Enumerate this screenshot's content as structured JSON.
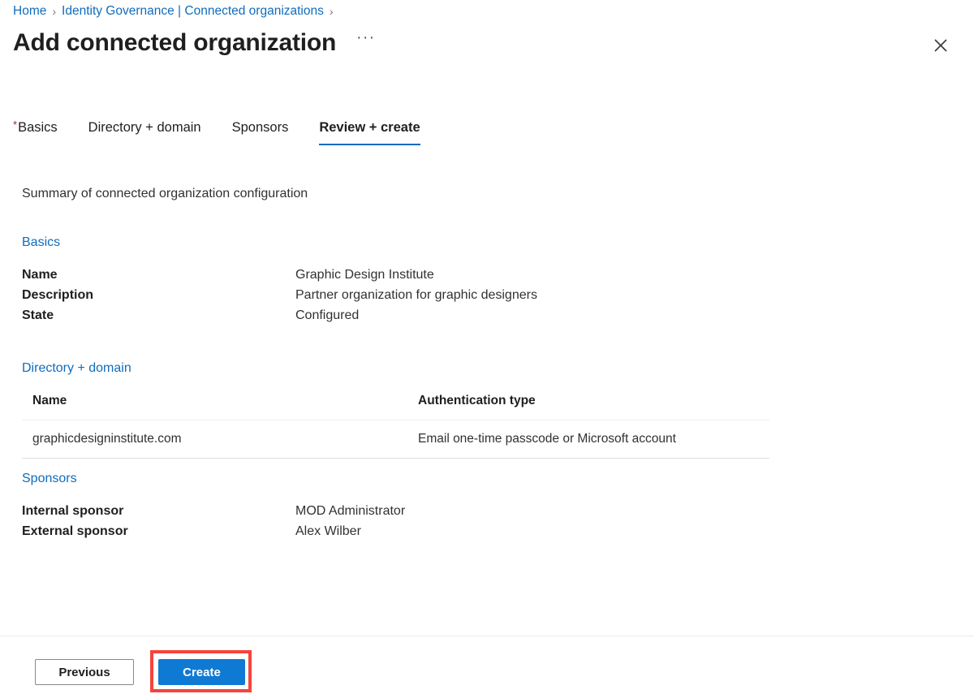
{
  "breadcrumb": {
    "items": [
      {
        "label": "Home"
      },
      {
        "label": "Identity Governance | Connected organizations"
      }
    ],
    "separator": "›"
  },
  "header": {
    "title": "Add connected organization",
    "ellipsis": "···",
    "close_icon": "close-icon"
  },
  "tabs": [
    {
      "label": "Basics",
      "required": true,
      "active": false
    },
    {
      "label": "Directory + domain",
      "required": false,
      "active": false
    },
    {
      "label": "Sponsors",
      "required": false,
      "active": false
    },
    {
      "label": "Review + create",
      "required": false,
      "active": true
    }
  ],
  "main": {
    "summary_text": "Summary of connected organization configuration",
    "sections": {
      "basics": {
        "link_label": "Basics",
        "rows": [
          {
            "key": "Name",
            "value": "Graphic Design Institute"
          },
          {
            "key": "Description",
            "value": "Partner organization for graphic designers"
          },
          {
            "key": "State",
            "value": "Configured"
          }
        ]
      },
      "directory_domain": {
        "link_label": "Directory + domain",
        "columns": [
          "Name",
          "Authentication type"
        ],
        "rows": [
          [
            "graphicdesigninstitute.com",
            "Email one-time passcode or Microsoft account"
          ]
        ]
      },
      "sponsors": {
        "link_label": "Sponsors",
        "rows": [
          {
            "key": "Internal sponsor",
            "value": "MOD Administrator"
          },
          {
            "key": "External sponsor",
            "value": "Alex Wilber"
          }
        ]
      }
    }
  },
  "footer": {
    "previous_label": "Previous",
    "create_label": "Create"
  },
  "colors": {
    "accent_blue": "#0f6cbd",
    "primary_button": "#0f7ad4",
    "required_red": "#a4262c",
    "highlight_red": "#f5453c",
    "text_primary": "#201f1e"
  }
}
